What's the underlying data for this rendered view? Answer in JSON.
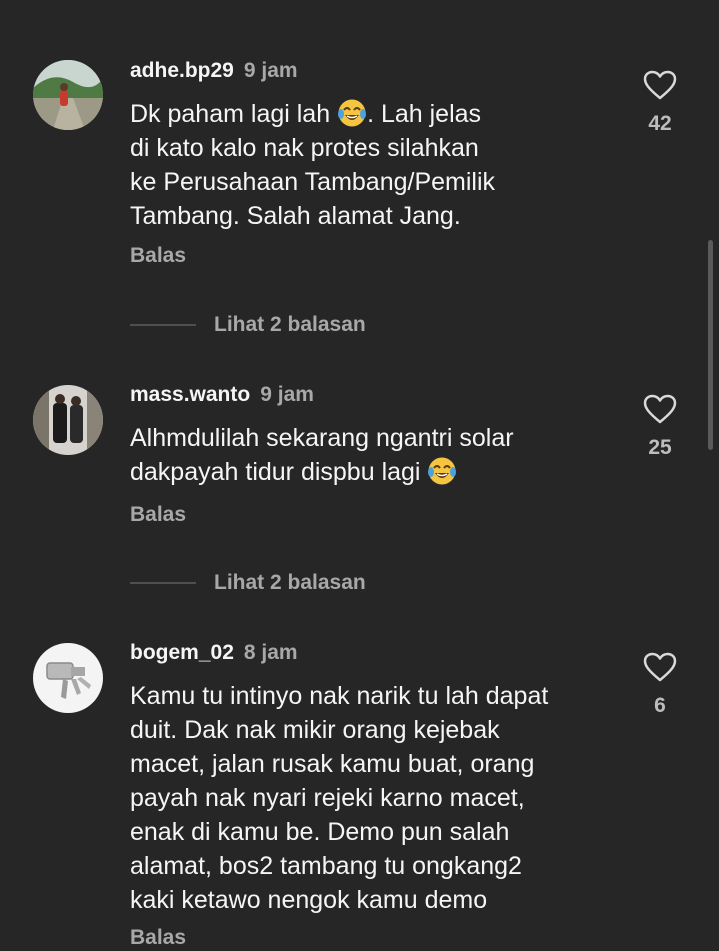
{
  "comments": [
    {
      "username": "adhe.bp29",
      "time": "9 jam",
      "lines": [
        "Dk paham lagi lah",
        ". Lah jelas",
        "di kato kalo nak protes silahkan",
        "ke Perusahaan Tambang/Pemilik",
        "Tambang. Salah alamat Jang."
      ],
      "emoji": "tears-of-joy",
      "likes": "42",
      "reply_label": "Balas",
      "view_replies": "Lihat 2 balasan"
    },
    {
      "username": "mass.wanto",
      "time": "9 jam",
      "lines": [
        "Alhmdulilah sekarang ngantri solar",
        "dakpayah tidur dispbu lagi"
      ],
      "emoji": "tears-of-joy",
      "likes": "25",
      "reply_label": "Balas",
      "view_replies": "Lihat 2 balasan"
    },
    {
      "username": "bogem_02",
      "time": "8 jam",
      "lines": [
        "Kamu tu intinyo nak narik tu lah dapat",
        "duit. Dak nak mikir orang kejebak",
        "macet, jalan rusak kamu buat, orang",
        "payah nak nyari rejeki karno macet,",
        "enak di kamu be. Demo pun salah",
        "alamat, bos2 tambang tu ongkang2",
        "kaki ketawo nengok kamu demo"
      ],
      "likes": "6",
      "reply_label": "Balas"
    }
  ],
  "icons": {
    "like": "heart-outline-icon",
    "emoji": "face-with-tears-of-joy-icon"
  },
  "colors": {
    "background": "#262626",
    "primary_text": "#f5f5f5",
    "secondary_text": "#a8a8a8"
  }
}
